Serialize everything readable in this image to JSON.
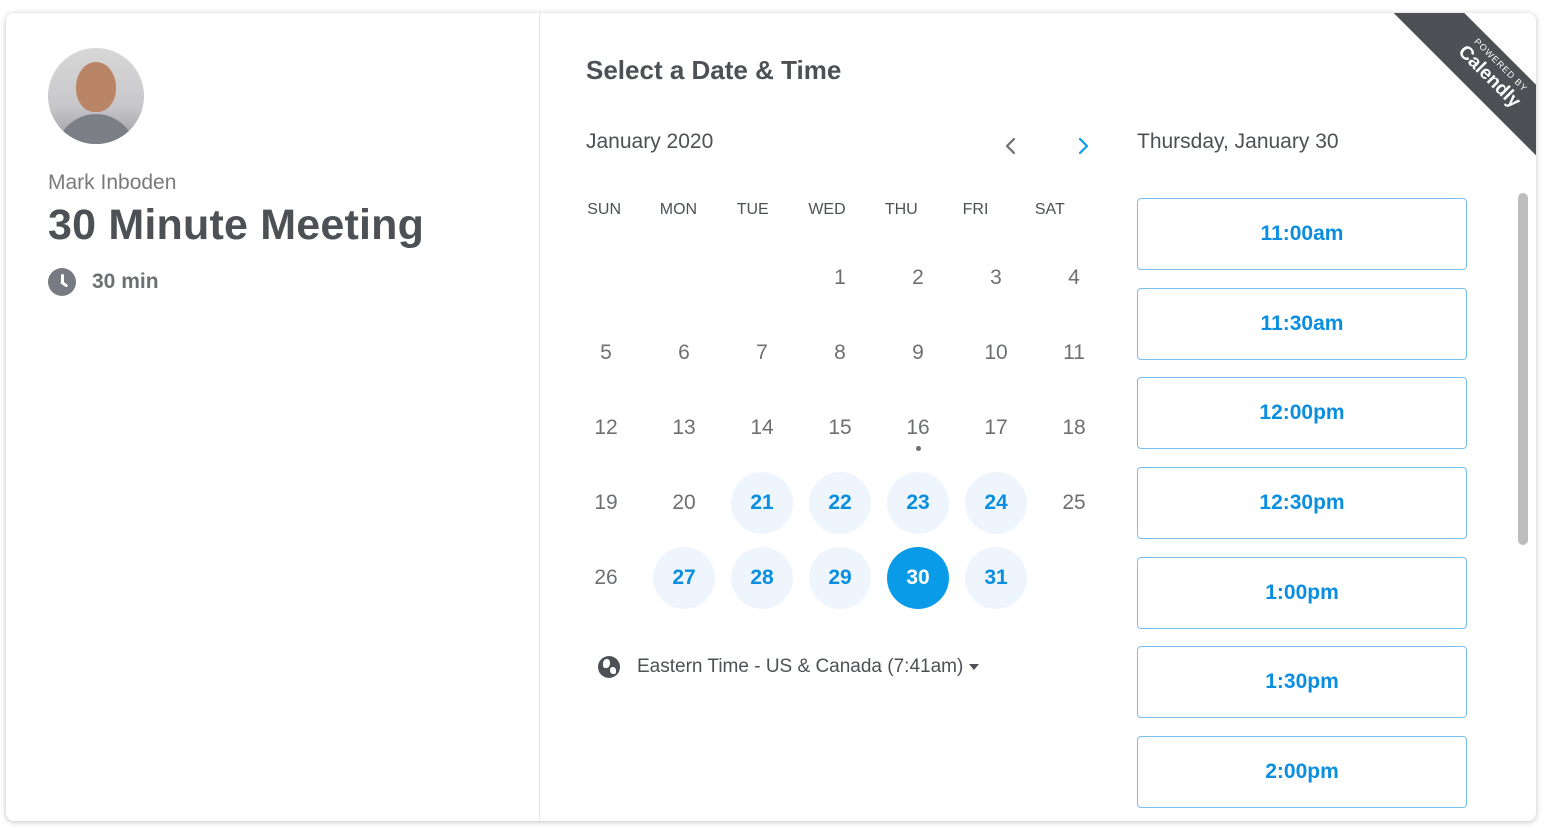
{
  "owner": {
    "name": "Mark Inboden"
  },
  "event": {
    "title": "30 Minute Meeting",
    "duration": "30 min"
  },
  "calendar": {
    "heading": "Select a Date & Time",
    "month_label": "January 2020",
    "weekdays": [
      "SUN",
      "MON",
      "TUE",
      "WED",
      "THU",
      "FRI",
      "SAT"
    ],
    "weeks": [
      [
        {
          "d": ""
        },
        {
          "d": ""
        },
        {
          "d": ""
        },
        {
          "d": "1"
        },
        {
          "d": "2"
        },
        {
          "d": "3"
        },
        {
          "d": "4"
        }
      ],
      [
        {
          "d": "5"
        },
        {
          "d": "6"
        },
        {
          "d": "7"
        },
        {
          "d": "8"
        },
        {
          "d": "9"
        },
        {
          "d": "10"
        },
        {
          "d": "11"
        }
      ],
      [
        {
          "d": "12"
        },
        {
          "d": "13"
        },
        {
          "d": "14"
        },
        {
          "d": "15"
        },
        {
          "d": "16",
          "today": true
        },
        {
          "d": "17"
        },
        {
          "d": "18"
        }
      ],
      [
        {
          "d": "19"
        },
        {
          "d": "20"
        },
        {
          "d": "21",
          "avail": true
        },
        {
          "d": "22",
          "avail": true
        },
        {
          "d": "23",
          "avail": true
        },
        {
          "d": "24",
          "avail": true
        },
        {
          "d": "25"
        }
      ],
      [
        {
          "d": "26"
        },
        {
          "d": "27",
          "avail": true
        },
        {
          "d": "28",
          "avail": true
        },
        {
          "d": "29",
          "avail": true
        },
        {
          "d": "30",
          "selected": true
        },
        {
          "d": "31",
          "avail": true
        },
        {
          "d": ""
        }
      ]
    ]
  },
  "timezone": {
    "label": "Eastern Time - US & Canada (7:41am)"
  },
  "times": {
    "date_heading": "Thursday, January 30",
    "slots": [
      "11:00am",
      "11:30am",
      "12:00pm",
      "12:30pm",
      "1:00pm",
      "1:30pm",
      "2:00pm"
    ]
  },
  "ribbon": {
    "small_text": "POWERED BY",
    "brand": "Calendly"
  },
  "colors": {
    "accent": "#0a9be8",
    "available_bg": "#eef5fc",
    "text": "#4d5055",
    "ribbon": "#4d5055"
  },
  "icons": {
    "duration": "clock-icon",
    "timezone": "globe-icon",
    "prev": "chevron-left-icon",
    "next": "chevron-right-icon"
  }
}
